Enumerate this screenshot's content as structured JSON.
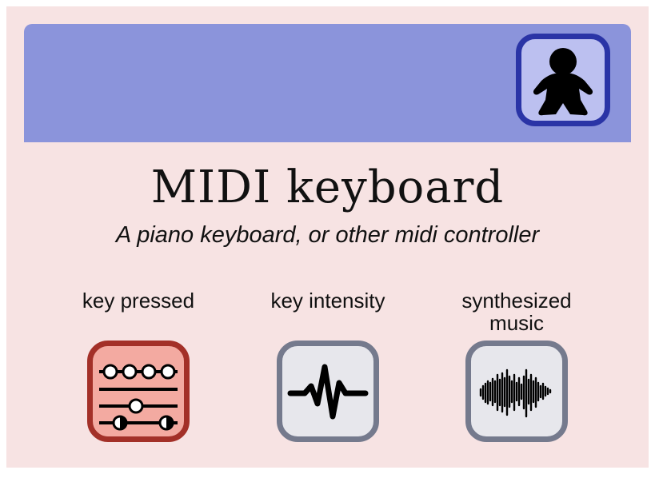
{
  "card": {
    "title": "MIDI keyboard",
    "subtitle": "A piano keyboard, or other midi controller",
    "avatar_icon": "user-meeple-icon"
  },
  "outputs": [
    {
      "label": "key pressed",
      "icon": "sliders-icon",
      "color": "#a33028"
    },
    {
      "label": "key intensity",
      "icon": "pulse-icon",
      "color": "#757a8d"
    },
    {
      "label": "synthesized music",
      "icon": "waveform-icon",
      "color": "#757a8d"
    }
  ],
  "colors": {
    "background": "#f7e3e3",
    "header": "#8b94db",
    "avatar_border": "#2a34a6",
    "avatar_fill": "#bcc0f0"
  }
}
